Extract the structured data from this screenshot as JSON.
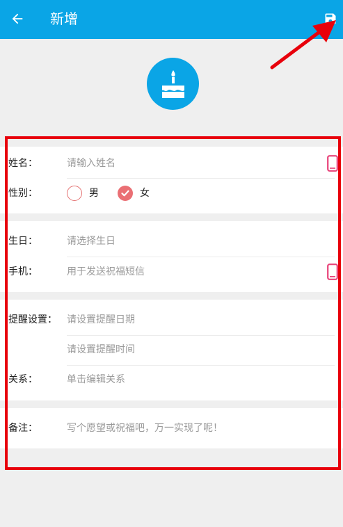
{
  "header": {
    "title": "新增",
    "back_icon": "arrow-left-icon",
    "save_icon": "floppy-disk-icon",
    "background_color": "#0aa5e6"
  },
  "avatar": {
    "icon": "birthday-cake-icon"
  },
  "form": {
    "name": {
      "label": "姓名：",
      "placeholder": "请输入姓名",
      "icon": "mobile-phone-icon"
    },
    "gender": {
      "label": "性别：",
      "options": [
        {
          "label": "男",
          "selected": false
        },
        {
          "label": "女",
          "selected": true
        }
      ]
    },
    "birthday": {
      "label": "生日：",
      "placeholder": "请选择生日"
    },
    "phone": {
      "label": "手机：",
      "placeholder": "用于发送祝福短信",
      "icon": "mobile-phone-icon"
    },
    "reminder": {
      "label": "提醒设置：",
      "date_placeholder": "请设置提醒日期",
      "time_placeholder": "请设置提醒时间"
    },
    "relation": {
      "label": "关系：",
      "placeholder": "单击编辑关系"
    },
    "note": {
      "label": "备注：",
      "placeholder": "写个愿望或祝福吧，万一实现了呢！"
    }
  },
  "colors": {
    "accent": "#0aa5e6",
    "radio": "#ea6f74",
    "phone_icon": "#e8447a",
    "annotation": "#e8000b"
  }
}
